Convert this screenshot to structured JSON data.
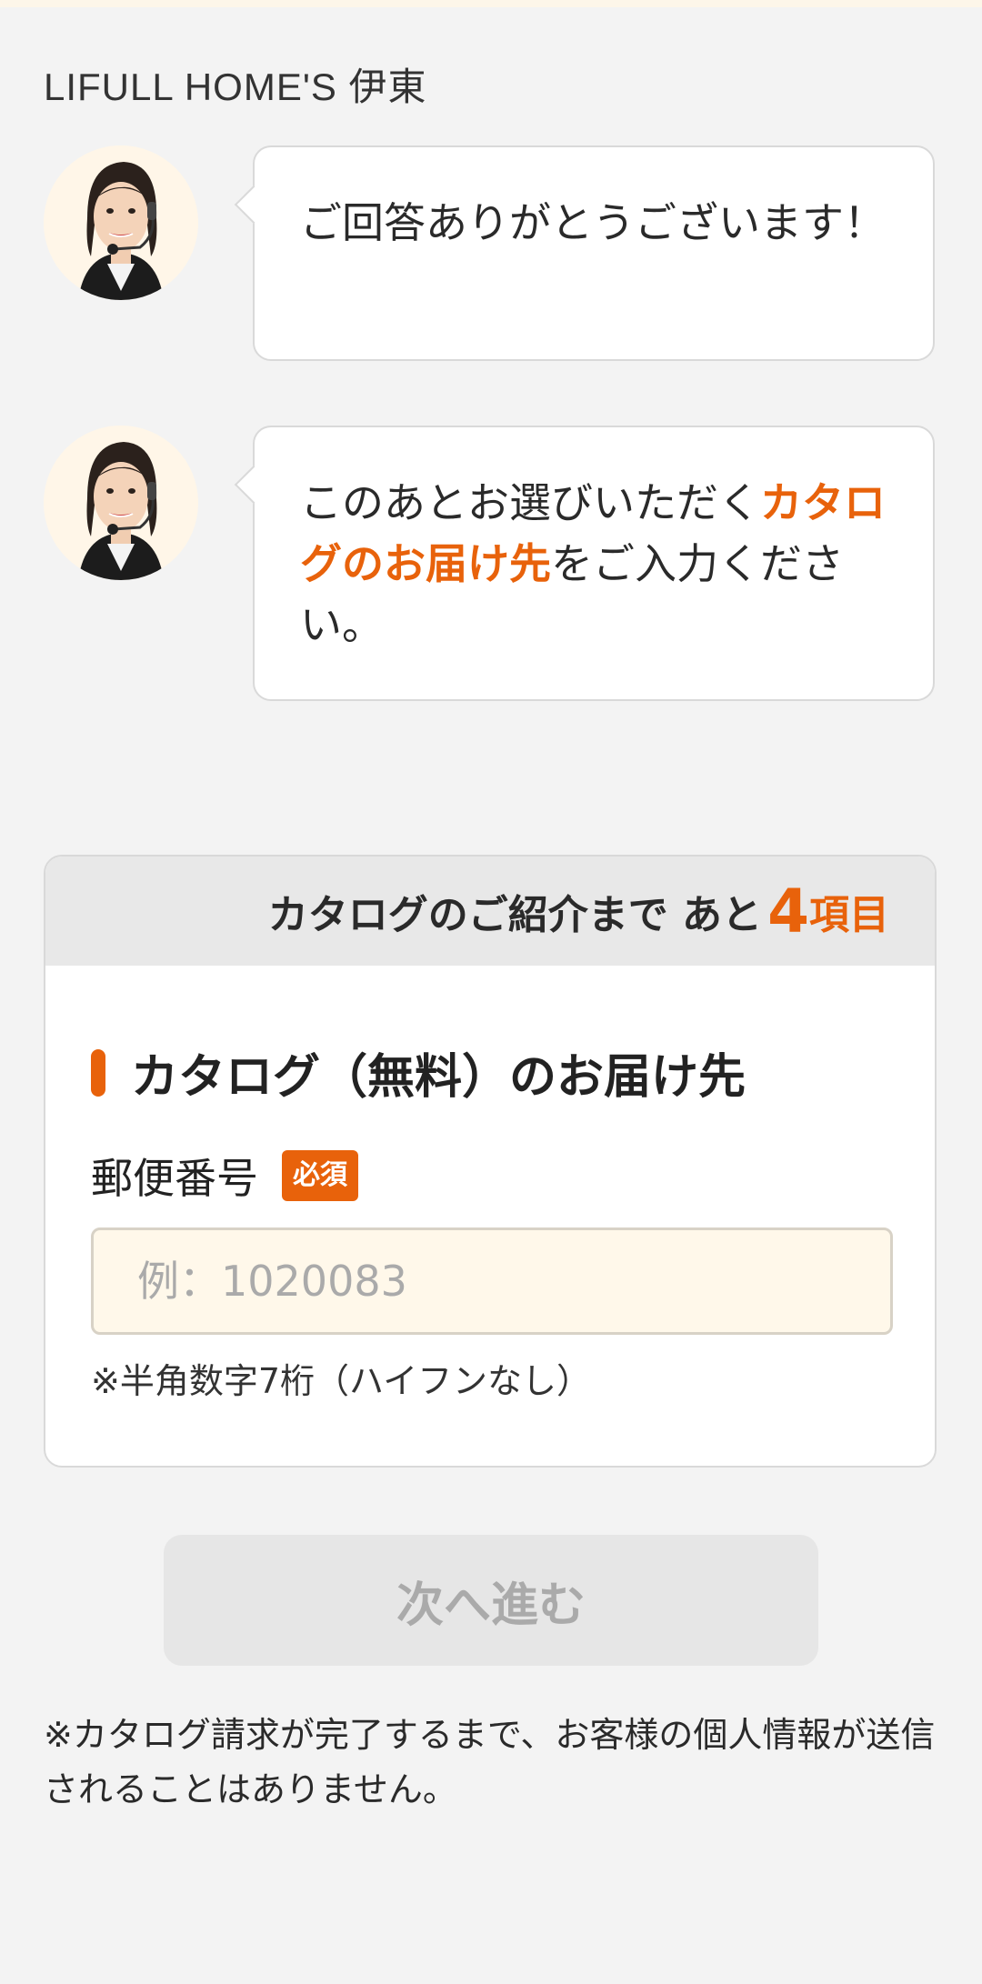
{
  "brand": {
    "name": "LIFULL HOME'S 伊東"
  },
  "chat": {
    "message1": "ご回答ありがとうございます！",
    "message2": {
      "before": "このあとお選びいただく",
      "highlight": "カタログのお届け先",
      "after": "をご入力ください。"
    }
  },
  "progress": {
    "prefix": "カタログのご紹介まで あと",
    "count": "4",
    "unit": "項目"
  },
  "form": {
    "section_title": "カタログ（無料）のお届け先",
    "postal": {
      "label": "郵便番号",
      "required_badge": "必須",
      "placeholder": "例：1020083",
      "value": "",
      "hint": "※半角数字7桁（ハイフンなし）"
    }
  },
  "next_button": {
    "label": "次へ進む",
    "enabled": false
  },
  "notice": "※カタログ請求が完了するまで、お客様の個人情報が送信されることはありません。",
  "colors": {
    "accent": "#e8620b",
    "page_bg": "#f3f3f3",
    "input_bg": "#fff8ea",
    "disabled_button_bg": "#e6e6e6"
  },
  "icons": {
    "avatar": "operator-avatar-icon"
  }
}
